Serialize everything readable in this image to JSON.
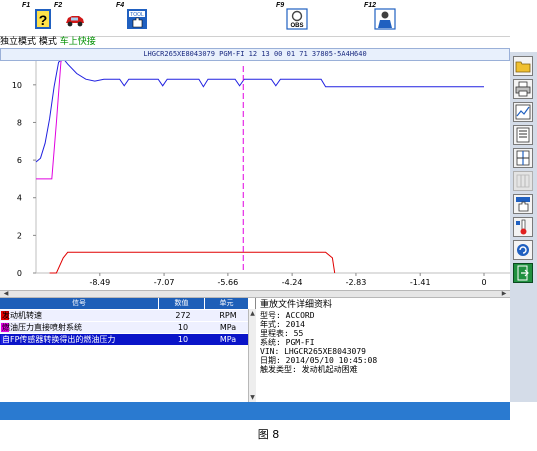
{
  "colors": {
    "toolbar_icon": "#2060c0",
    "header_bg": "#e8f0fc",
    "accent": "#1d5fb8",
    "series_rpm": "#e00000",
    "series_pressure": "#e000e0",
    "series_sensor": "#2020e0"
  },
  "toolbar": {
    "keys": [
      {
        "label": "F1",
        "icon": "help-icon"
      },
      {
        "label": "F2",
        "icon": "car-icon"
      },
      {
        "label": "F4",
        "icon": "tool-hand-icon"
      },
      {
        "label": "F9",
        "icon": "obs-icon"
      },
      {
        "label": "F12",
        "icon": "person-icon"
      }
    ],
    "obs_text": "OBS"
  },
  "modebar": {
    "mode_label": "独立模式",
    "mode_title": "模式",
    "mode_value": "车上快接"
  },
  "header": {
    "text": "LHGCR265XE8043079 PGM-FI 12 13 00 01 71 37805-5A4H640"
  },
  "chart_data": {
    "type": "line",
    "x_ticks": [
      "-8.49",
      "-7.07",
      "-5.66",
      "-4.24",
      "-2.83",
      "-1.41",
      "0"
    ],
    "y_ticks": [
      "0",
      "2",
      "4",
      "6",
      "8",
      "10"
    ],
    "xlim": [
      -9.9,
      0
    ],
    "ylim": [
      0,
      11
    ],
    "grid": false,
    "cursor_x": -5.32,
    "series": [
      {
        "color_key": "series_sensor",
        "points": [
          [
            -9.9,
            5.9
          ],
          [
            -9.8,
            6.1
          ],
          [
            -9.7,
            6.9
          ],
          [
            -9.6,
            8.2
          ],
          [
            -9.5,
            9.9
          ],
          [
            -9.4,
            11.2
          ],
          [
            -9.3,
            11.4
          ],
          [
            -9.2,
            11.1
          ],
          [
            -9.0,
            10.6
          ],
          [
            -8.8,
            10.3
          ],
          [
            -8.6,
            10.2
          ],
          [
            -8.4,
            10.3
          ],
          [
            -8.2,
            10.3
          ],
          [
            -8.05,
            10.3
          ],
          [
            -7.95,
            9.95
          ],
          [
            -7.85,
            10.3
          ],
          [
            -7.2,
            10.3
          ],
          [
            -7.1,
            9.95
          ],
          [
            -7.0,
            10.3
          ],
          [
            -6.3,
            10.3
          ],
          [
            -6.2,
            9.9
          ],
          [
            -6.1,
            10.3
          ],
          [
            -5.5,
            10.3
          ],
          [
            -5.4,
            9.95
          ],
          [
            -5.3,
            10.3
          ],
          [
            -4.7,
            10.3
          ],
          [
            -4.6,
            9.95
          ],
          [
            -4.5,
            10.3
          ],
          [
            -3.6,
            10.3
          ],
          [
            -3.5,
            9.9
          ],
          [
            0,
            9.9
          ]
        ]
      },
      {
        "color_key": "series_pressure",
        "points": [
          [
            -9.9,
            5.0
          ],
          [
            -9.55,
            5.0
          ],
          [
            -9.45,
            8.0
          ],
          [
            -9.35,
            11.2
          ],
          [
            -9.3,
            11.6
          ],
          [
            0,
            11.6
          ]
        ]
      },
      {
        "color_key": "series_rpm",
        "points": [
          [
            -9.6,
            0
          ],
          [
            -9.45,
            0
          ],
          [
            -9.3,
            0.8
          ],
          [
            -9.2,
            1.1
          ],
          [
            -3.5,
            1.1
          ],
          [
            -3.35,
            0.8
          ],
          [
            -3.3,
            0
          ]
        ]
      }
    ]
  },
  "signals": {
    "headers": {
      "signal": "信号",
      "value": "数值",
      "unit": "单元"
    },
    "rows": [
      {
        "name": "发动机转速",
        "value": "272",
        "unit": "RPM",
        "swatch": "#e00000",
        "selected": false
      },
      {
        "name": "燃油压力直接喷射系统",
        "value": "10",
        "unit": "MPa",
        "swatch": "#e000e0",
        "selected": false
      },
      {
        "name": "自FP传感器转换得出的燃油压力",
        "value": "10",
        "unit": "MPa",
        "swatch": "#2020e0",
        "selected": true
      }
    ]
  },
  "details": {
    "title": "重放文件详细资料",
    "lines": [
      "型号: ACCORD",
      "年式: 2014",
      "里程表: 55",
      "系统: PGM-FI",
      "VIN: LHGCR265XE8043079",
      "日期: 2014/05/10 10:45:08",
      "触发类型: 发动机起动困难"
    ]
  },
  "right_tools": [
    "folder-icon",
    "print-icon",
    "chart-icon",
    "list-icon",
    "split-icon",
    "grid-icon",
    "tool-hand-icon",
    "thermometer-icon",
    "refresh-icon",
    "exit-icon"
  ],
  "caption": "图 8"
}
